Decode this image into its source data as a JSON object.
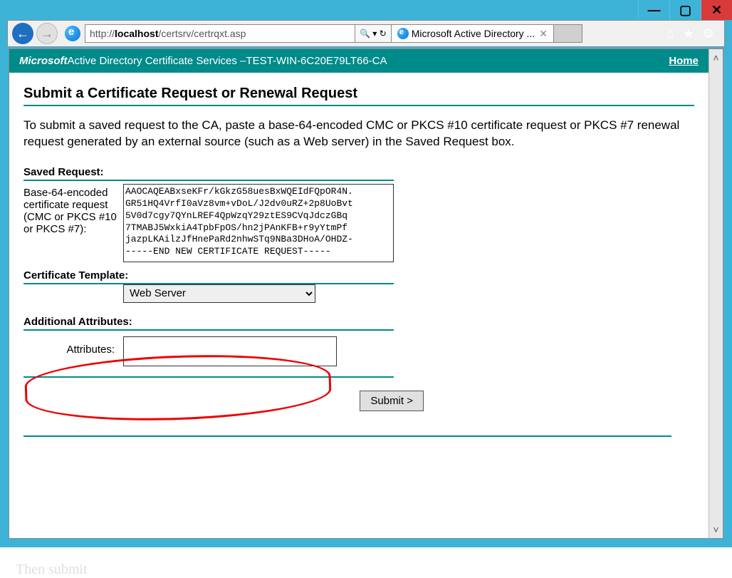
{
  "window": {
    "minimize": "—",
    "maximize": "▢",
    "close": "✕"
  },
  "browser": {
    "url_prefix": "http://",
    "url_host": "localhost",
    "url_path": "/certsrv/certrqxt.asp",
    "search_glyph": "🔍",
    "dropdown_glyph": "▾",
    "refresh_glyph": "↻",
    "tab_title": "Microsoft Active Directory ...",
    "tab_close": "✕",
    "home_icon": "⌂",
    "star_icon": "★",
    "gear_icon": "⚙"
  },
  "header": {
    "brand": "Microsoft",
    "product": " Active Directory Certificate Services  –  ",
    "ca_name": "TEST-WIN-6C20E79LT66-CA",
    "home": "Home"
  },
  "page": {
    "title": "Submit a Certificate Request or Renewal Request",
    "instruction": "To submit a saved request to the CA, paste a base-64-encoded CMC or PKCS #10 certificate request or PKCS #7 renewal request generated by an external source (such as a Web server) in the Saved Request box.",
    "saved_request_label": "Saved Request:",
    "req_field_label": "Base-64-encoded certificate request (CMC or PKCS #10 or PKCS #7):",
    "request_text": "AAOCAQEABxseKFr/kGkzG58uesBxWQEIdFQpOR4N.\nGR51HQ4VrfI0aVz8vm+vDoL/J2dv0uRZ+2p8UoBvt\n5V0d7cgy7QYnLREF4QpWzqY29ztES9CVqJdczGBq\n7TMABJ5WxkiA4TpbFpOS/hn2jPAnKFB+r9yYtmPf\njazpLKAilzJfHnePaRd2nhwSTq9NBa3DHoA/OHDZ-\n-----END NEW CERTIFICATE REQUEST-----",
    "template_label": "Certificate Template:",
    "template_value": "Web Server",
    "additional_label": "Additional Attributes:",
    "attr_label": "Attributes:",
    "attr_value": "",
    "submit": "Submit >"
  },
  "footer_hint": "Then submit"
}
